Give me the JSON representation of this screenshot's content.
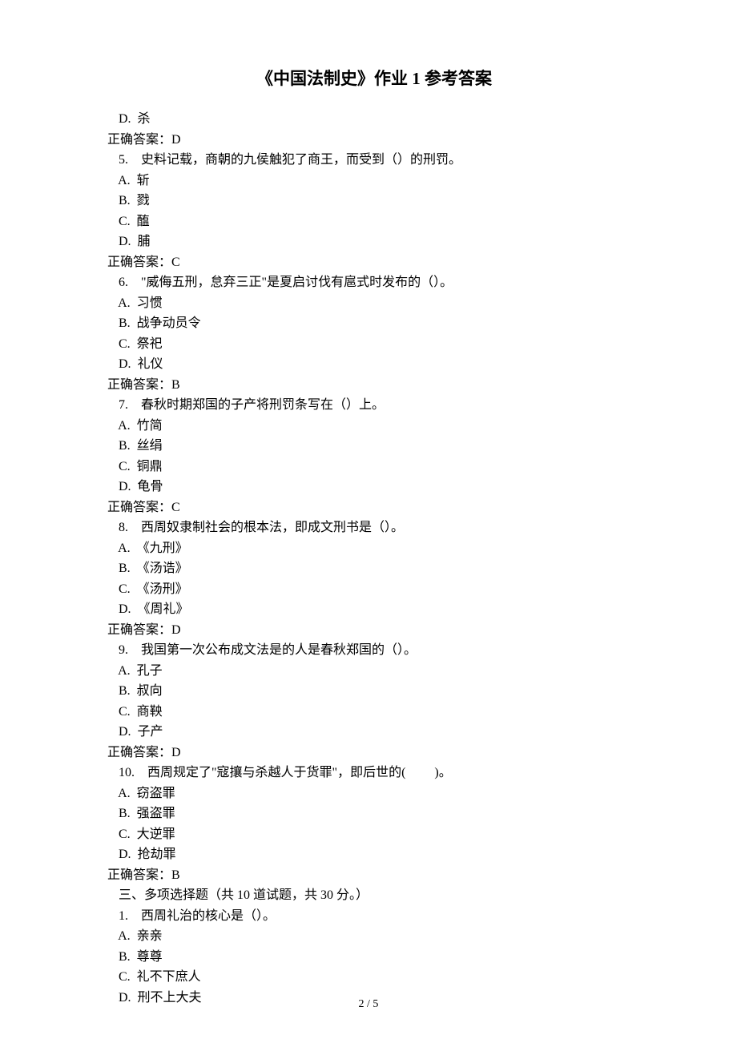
{
  "title": "《中国法制史》作业 1 参考答案",
  "lines": {
    "l0": " D.  杀",
    "l1": "正确答案：D",
    "l2": " 5.    史料记载，商朝的九侯触犯了商王，而受到（）的刑罚。",
    "l3": " A.  斩",
    "l4": " B.  戮",
    "l5": " C.  醢",
    "l6": " D.  脯",
    "l7": "正确答案：C",
    "l8": " 6.    \"威侮五刑，怠弃三正\"是夏启讨伐有扈式时发布的（）。",
    "l9": " A.  习惯",
    "l10": " B.  战争动员令",
    "l11": " C.  祭祀",
    "l12": " D.  礼仪",
    "l13": "正确答案：B",
    "l14": " 7.    春秋时期郑国的子产将刑罚条写在（）上。",
    "l15": " A.  竹简",
    "l16": " B.  丝绢",
    "l17": " C.  铜鼎",
    "l18": " D.  龟骨",
    "l19": "正确答案：C",
    "l20": " 8.    西周奴隶制社会的根本法，即成文刑书是（）。",
    "l21": " A.  《九刑》",
    "l22": " B.  《汤诰》",
    "l23": " C.  《汤刑》",
    "l24": " D.  《周礼》",
    "l25": "正确答案：D",
    "l26": " 9.    我国第一次公布成文法是的人是春秋郑国的（）。",
    "l27": " A.  孔子",
    "l28": " B.  叔向",
    "l29": " C.  商鞅",
    "l30": " D.  子产",
    "l31": "正确答案：D",
    "l32": " 10.    西周规定了\"寇攘与杀越人于货罪\"，即后世的(         )。",
    "l33": " A.  窃盗罪",
    "l34": " B.  强盗罪",
    "l35": " C.  大逆罪",
    "l36": " D.  抢劫罪",
    "l37": "正确答案：B",
    "l38": " 三、多项选择题（共 10 道试题，共 30 分。）",
    "l39": " 1.    西周礼治的核心是（）。",
    "l40": " A.  亲亲",
    "l41": " B.  尊尊",
    "l42": " C.  礼不下庶人",
    "l43": " D.  刑不上大夫"
  },
  "footer": "2 / 5"
}
